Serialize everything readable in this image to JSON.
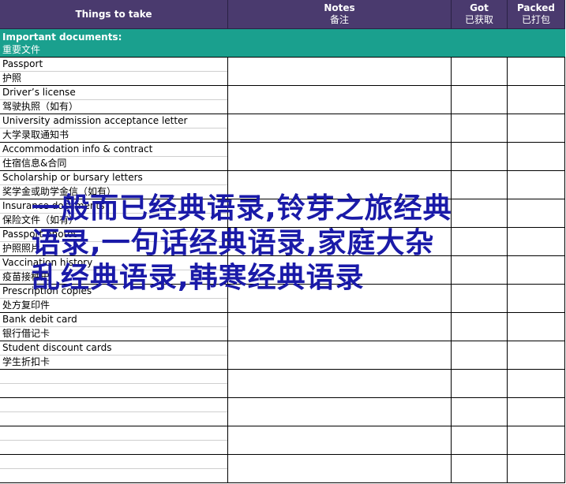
{
  "header": {
    "things": "Things to take",
    "notes_en": "Notes",
    "notes_cn": "备注",
    "got_en": "Got",
    "got_cn": "已获取",
    "packed_en": "Packed",
    "packed_cn": "已打包"
  },
  "section": {
    "title_en": "Important documents:",
    "title_cn": "重要文件"
  },
  "items": [
    {
      "en": "Passport",
      "cn": "护照"
    },
    {
      "en": "Driver’s license",
      "cn": "驾驶执照（如有）"
    },
    {
      "en": "University admission acceptance letter",
      "cn": "大学录取通知书"
    },
    {
      "en": "Accommodation info & contract",
      "cn": "住宿信息&合同"
    },
    {
      "en": "Scholarship or bursary letters",
      "cn": "奖学金或助学金信（如有）"
    },
    {
      "en": "Insurance documents",
      "cn": "保险文件（如有）"
    },
    {
      "en": "Passport photos",
      "cn": "护照照片"
    },
    {
      "en": "Vaccination history",
      "cn": "疫苗接种史"
    },
    {
      "en": "Prescription copies",
      "cn": "处方复印件"
    },
    {
      "en": "Bank debit card",
      "cn": "银行借记卡"
    },
    {
      "en": "Student discount cards",
      "cn": "学生折扣卡"
    },
    {
      "en": "",
      "cn": ""
    },
    {
      "en": "",
      "cn": ""
    },
    {
      "en": "",
      "cn": ""
    },
    {
      "en": "",
      "cn": ""
    }
  ],
  "watermark": {
    "line1": "一般而已经典语录,铃芽之旅经典",
    "line2": "语录,一句话经典语录,家庭大杂",
    "line3": "乱经典语录,韩寒经典语录"
  }
}
